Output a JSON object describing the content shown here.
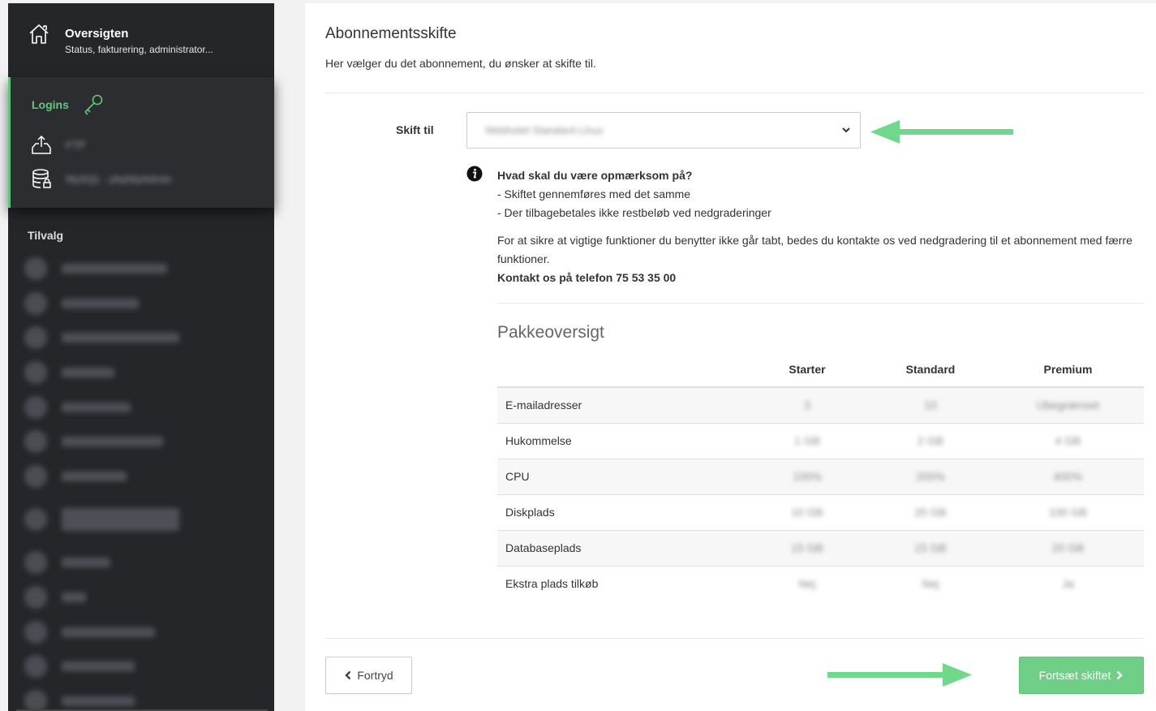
{
  "sidebar": {
    "overview": {
      "title": "Oversigten",
      "subtitle": "Status, fakturering, administrator...",
      "icon": "home-icon"
    },
    "logins": {
      "label": "Logins",
      "icon": "key-icon",
      "items": [
        {
          "icon": "upload-icon",
          "label": "FTP"
        },
        {
          "icon": "database-icon",
          "label": "MySQL - phpMyAdmin"
        }
      ]
    },
    "addons_title": "Tilvalg"
  },
  "main": {
    "title": "Abonnementsskifte",
    "description": "Her vælger du det abonnement, du ønsker at skifte til.",
    "switch_label": "Skift til",
    "select_value": "Webhotel Standard Linux",
    "notice": {
      "heading": "Hvad skal du være opmærksom på?",
      "line1": "- Skiftet gennemføres med det samme",
      "line2": "- Der tilbagebetales ikke restbeløb ved nedgraderinger",
      "paragraph": "For at sikre at vigtige funktioner du benytter ikke går tabt, bedes du kontakte os ved nedgradering til et abonnement med færre funktioner.",
      "contact": "Kontakt os på telefon 75 53 35 00"
    },
    "package_title": "Pakkeoversigt",
    "table": {
      "columns": [
        "",
        "Starter",
        "Standard",
        "Premium"
      ],
      "rows": [
        {
          "name": "E-mailadresser",
          "values": [
            "3",
            "10",
            "Ubegrænset"
          ]
        },
        {
          "name": "Hukommelse",
          "values": [
            "1 GB",
            "2 GB",
            "4 GB"
          ]
        },
        {
          "name": "CPU",
          "values": [
            "100%",
            "200%",
            "400%"
          ]
        },
        {
          "name": "Diskplads",
          "values": [
            "10 GB",
            "20 GB",
            "100 GB"
          ]
        },
        {
          "name": "Databaseplads",
          "values": [
            "15 GB",
            "15 GB",
            "20 GB"
          ]
        },
        {
          "name": "Ekstra plads tilkøb",
          "values": [
            "Nej",
            "Nej",
            "Ja"
          ]
        }
      ]
    },
    "cancel_label": "Fortryd",
    "continue_label": "Fortsæt skiftet"
  },
  "colors": {
    "accent_green": "#6fcf87",
    "sidebar_bg": "#24262a",
    "arrow_green": "#6fd88a"
  }
}
